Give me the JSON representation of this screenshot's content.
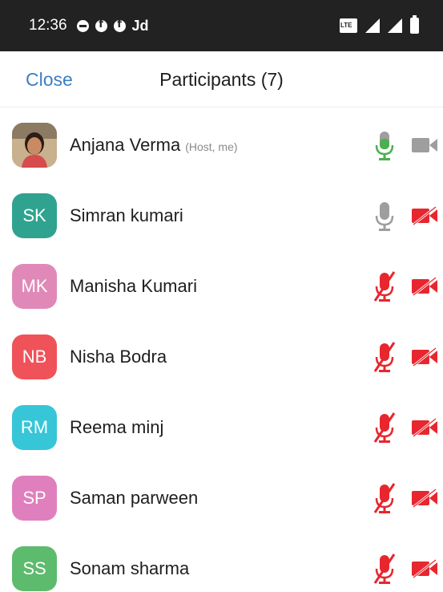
{
  "status_bar": {
    "time": "12:36",
    "carrier_text": "Jd",
    "icons": [
      "messenger-icon",
      "facebook-icon",
      "facebook-icon",
      "volte-lte-icon",
      "signal-icon",
      "battery-icon"
    ]
  },
  "header": {
    "close_label": "Close",
    "title": "Participants (7)"
  },
  "colors": {
    "accent": "#3b7fc4",
    "mic_on": "#4caf50",
    "muted_red": "#e8262e",
    "icon_gray": "#9e9e9e"
  },
  "participants": [
    {
      "name": "Anjana Verma",
      "role": "(Host, me)",
      "initials": "",
      "avatar_color": "#b99a76",
      "photo": true,
      "mic": "active",
      "video": "off-gray"
    },
    {
      "name": "Simran kumari",
      "role": "",
      "initials": "SK",
      "avatar_color": "#2fa38f",
      "photo": false,
      "mic": "idle",
      "video": "off"
    },
    {
      "name": "Manisha Kumari",
      "role": "",
      "initials": "MK",
      "avatar_color": "#e089b8",
      "photo": false,
      "mic": "muted",
      "video": "off"
    },
    {
      "name": "Nisha Bodra",
      "role": "",
      "initials": "NB",
      "avatar_color": "#f0525a",
      "photo": false,
      "mic": "muted",
      "video": "off"
    },
    {
      "name": "Reema minj",
      "role": "",
      "initials": "RM",
      "avatar_color": "#36c6d8",
      "photo": false,
      "mic": "muted",
      "video": "off"
    },
    {
      "name": "Saman parween",
      "role": "",
      "initials": "SP",
      "avatar_color": "#e07fbd",
      "photo": false,
      "mic": "muted",
      "video": "off"
    },
    {
      "name": "Sonam sharma",
      "role": "",
      "initials": "SS",
      "avatar_color": "#5dbb6d",
      "photo": false,
      "mic": "muted",
      "video": "off"
    }
  ]
}
